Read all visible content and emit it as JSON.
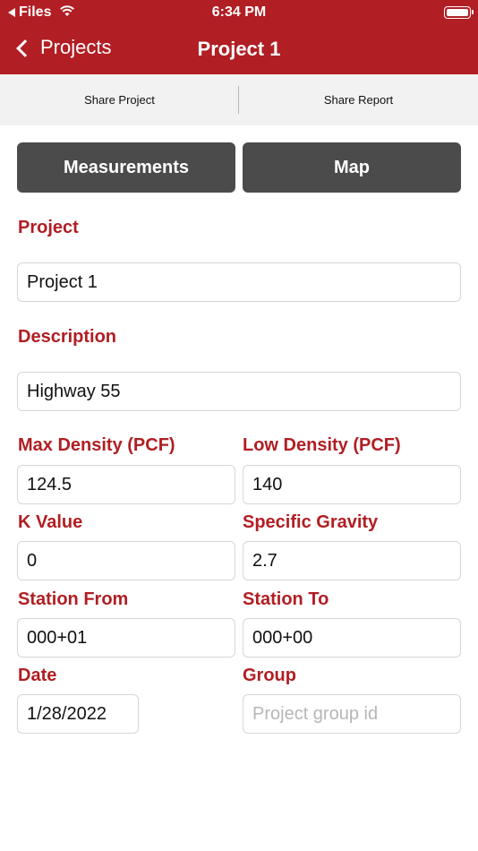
{
  "status_bar": {
    "back_app_label": "Files",
    "time": "6:34 PM"
  },
  "nav": {
    "back_label": "Projects",
    "title": "Project 1"
  },
  "share_bar": {
    "share_project_label": "Share Project",
    "share_report_label": "Share Report"
  },
  "tabs": {
    "measurements_label": "Measurements",
    "map_label": "Map"
  },
  "form": {
    "project": {
      "label": "Project",
      "value": "Project 1"
    },
    "description": {
      "label": "Description",
      "value": "Highway 55"
    },
    "max_density": {
      "label": "Max Density (PCF)",
      "value": "124.5"
    },
    "low_density": {
      "label": "Low Density (PCF)",
      "value": "140"
    },
    "k_value": {
      "label": "K Value",
      "value": "0"
    },
    "specific_gravity": {
      "label": "Specific Gravity",
      "value": "2.7"
    },
    "station_from": {
      "label": "Station From",
      "value": "000+01"
    },
    "station_to": {
      "label": "Station To",
      "value": "000+00"
    },
    "date": {
      "label": "Date",
      "value": "1/28/2022"
    },
    "group": {
      "label": "Group",
      "value": "",
      "placeholder": "Project group id"
    }
  },
  "colors": {
    "brand_red": "#b11e23",
    "tab_gray": "#4b4b4b"
  }
}
